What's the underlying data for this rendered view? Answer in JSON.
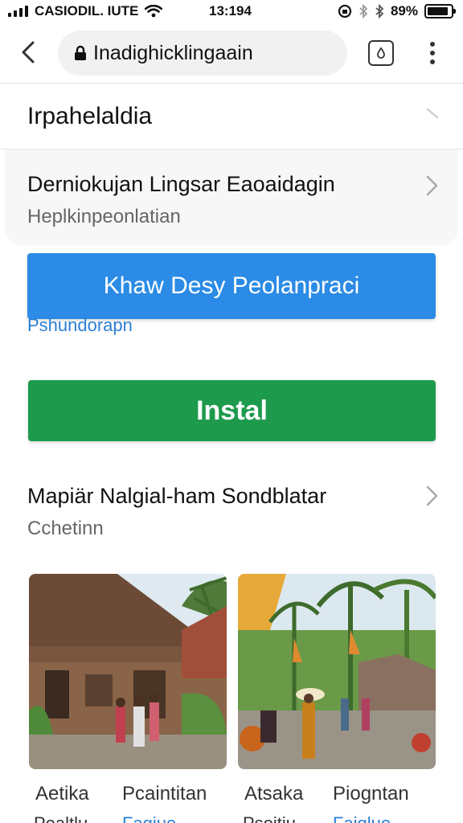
{
  "status_bar": {
    "carrier": "CASIODIL. IUTE",
    "time": "13:194",
    "battery": "89%",
    "battery_level": 0.89
  },
  "browser": {
    "url": "Inadighicklingaain",
    "icons": [
      "chevron-left-icon",
      "lock-icon",
      "tabs-icon",
      "more-vertical-icon"
    ]
  },
  "page": {
    "title": "Irpahelaldia"
  },
  "section1": {
    "title": "Derniokujan Lingsar Eaoaidagin",
    "subtitle": "Heplkinpeonlatian"
  },
  "primary_button": {
    "label": "Khaw Desy Peolanpraci",
    "sublabel": "Pshundorapn"
  },
  "install_button": {
    "label": "Instal"
  },
  "section2": {
    "title": "Mapiär Nalgial-ham Sondblatar",
    "subtitle": "Cchetinn"
  },
  "gallery": {
    "captions": [
      {
        "main": "Aetika",
        "secondary": "Pealtlu"
      },
      {
        "main": "Pcaintitan",
        "secondary": "Fagiue"
      },
      {
        "main": "Atsaka",
        "secondary": "Psoitiu"
      },
      {
        "main": "Piogntan",
        "secondary": "Faiglue"
      }
    ]
  },
  "colors": {
    "primary_blue": "#2b8be6",
    "install_green": "#1e9a4d",
    "link_blue": "#2b7fd6"
  }
}
